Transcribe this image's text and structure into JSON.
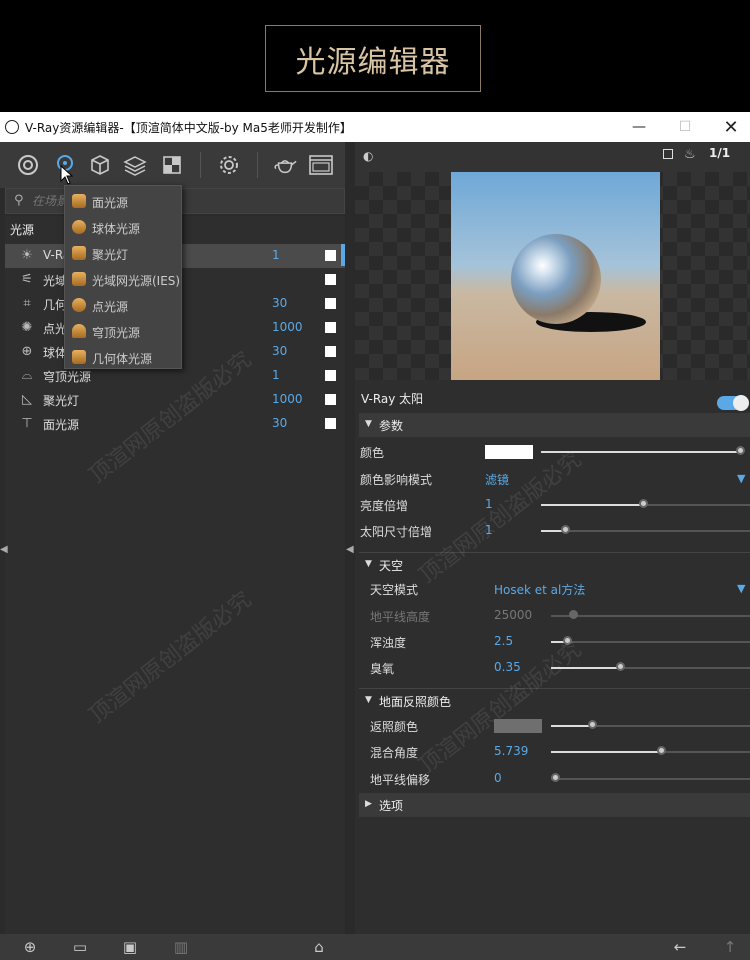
{
  "banner": {
    "title": "光源编辑器"
  },
  "window": {
    "title": "V-Ray资源编辑器-【顶渲简体中文版-by Ma5老师开发制作】",
    "minimize": "—",
    "maximize": "☐",
    "close": "✕"
  },
  "toolbar": {
    "icons": [
      "materials-icon",
      "lights-icon",
      "geometry-icon",
      "layers-icon",
      "textures-icon",
      "settings-icon",
      "render-teapot-icon",
      "frame-buffer-icon"
    ]
  },
  "search": {
    "placeholder": "在场景..."
  },
  "tree": {
    "header": "光源",
    "rows": [
      {
        "label": "V-Ra",
        "value": "1",
        "icon": "☀"
      },
      {
        "label": "光域",
        "value": "",
        "icon": "⚟"
      },
      {
        "label": "几何",
        "value": "30",
        "icon": "⌗"
      },
      {
        "label": "点光",
        "value": "1000",
        "icon": "✺"
      },
      {
        "label": "球体",
        "value": "30",
        "icon": "⊕"
      },
      {
        "label": "穹顶光源",
        "value": "1",
        "icon": "⌓"
      },
      {
        "label": "聚光灯",
        "value": "1000",
        "icon": "◺"
      },
      {
        "label": "面光源",
        "value": "30",
        "icon": "⊤"
      }
    ]
  },
  "dropdown": {
    "items": [
      "面光源",
      "球体光源",
      "聚光灯",
      "光域网光源(IES)",
      "点光源",
      "穹顶光源",
      "几何体光源"
    ]
  },
  "preview": {
    "counter": "1/1"
  },
  "sun": {
    "title": "V-Ray 太阳",
    "params_section": "参数",
    "color_label": "颜色",
    "color_mode_label": "颜色影响模式",
    "color_mode_value": "滤镜",
    "intensity_label": "亮度倍增",
    "intensity_value": "1",
    "size_label": "太阳尺寸倍增",
    "size_value": "1",
    "sky_section": "天空",
    "sky_model_label": "天空模式",
    "sky_model_value": "Hosek et al方法",
    "horizon_label": "地平线高度",
    "horizon_value": "25000",
    "turbidity_label": "浑浊度",
    "turbidity_value": "2.5",
    "ozone_label": "臭氧",
    "ozone_value": "0.35",
    "ground_section": "地面反照颜色",
    "albedo_label": "返照颜色",
    "blend_label": "混合角度",
    "blend_value": "5.739",
    "horizon_offset_label": "地平线偏移",
    "horizon_offset_value": "0",
    "options_section": "选项"
  },
  "colors": {
    "accent": "#5aa9e6",
    "panel": "#2e2e2e",
    "toolbar": "#3a3a3a"
  },
  "watermark": {
    "text": "顶渲网原创盗版必究"
  }
}
